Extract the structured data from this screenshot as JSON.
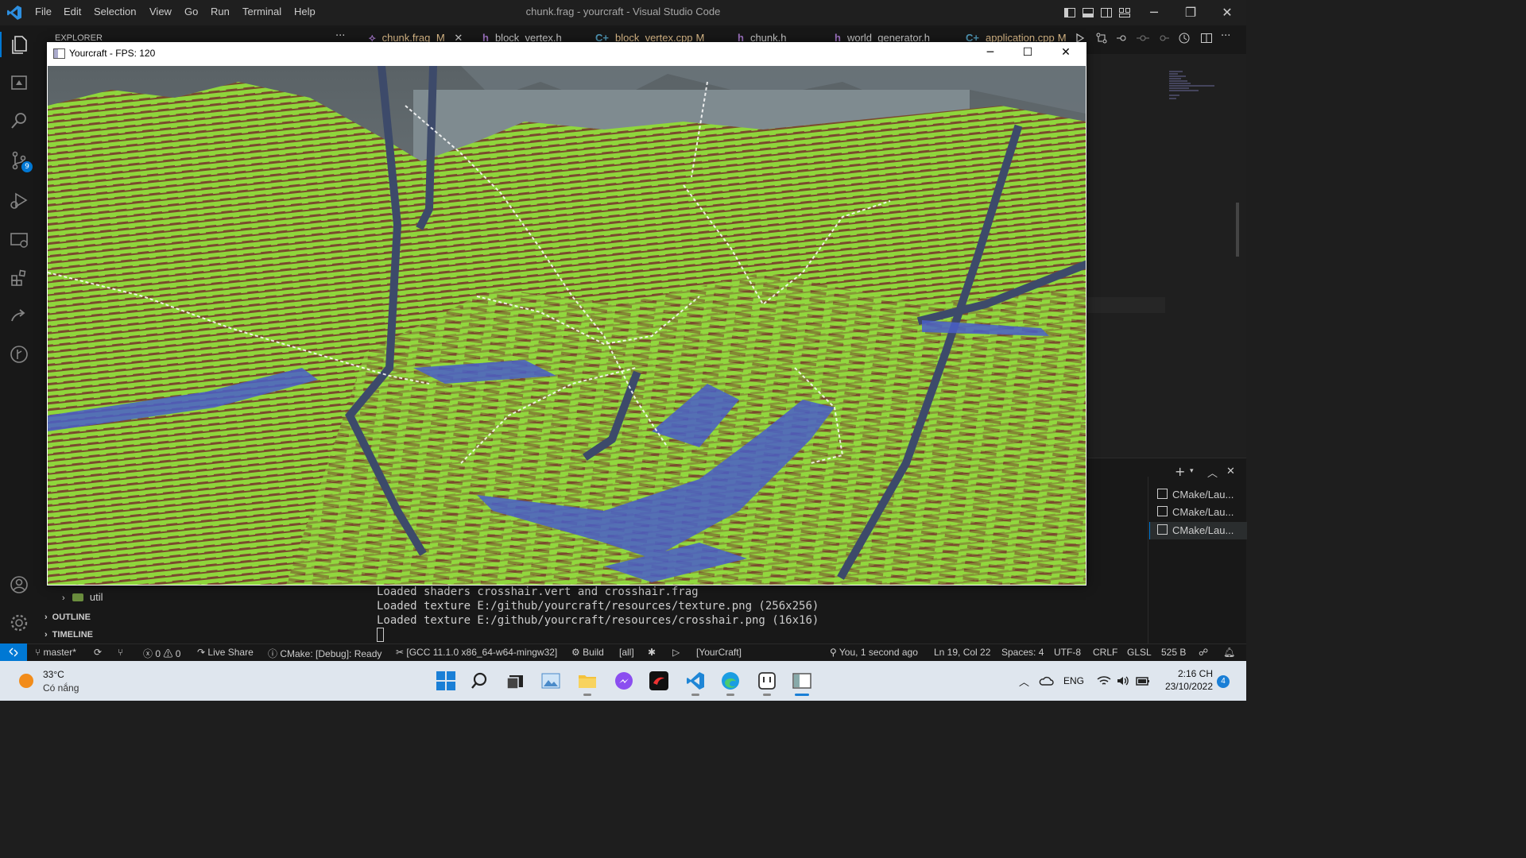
{
  "vscode": {
    "menu": [
      "File",
      "Edit",
      "Selection",
      "View",
      "Go",
      "Run",
      "Terminal",
      "Help"
    ],
    "window_title": "chunk.frag - yourcraft - Visual Studio Code"
  },
  "activity": {
    "scm_badge": "9"
  },
  "sidebar": {
    "title": "EXPLORER",
    "more": "···",
    "folder_util": "util",
    "outline": "OUTLINE",
    "timeline": "TIMELINE"
  },
  "tabs": [
    {
      "prefix": "",
      "label": "chunk.frag",
      "suffix": "M",
      "color": "#e2c08d"
    },
    {
      "prefix": "h",
      "label": "block_vertex.h",
      "suffix": "",
      "color": "#cccccc"
    },
    {
      "prefix": "C+",
      "label": "block_vertex.cpp",
      "suffix": "M",
      "color": "#e2c08d"
    },
    {
      "prefix": "h",
      "label": "chunk.h",
      "suffix": "",
      "color": "#cccccc"
    },
    {
      "prefix": "h",
      "label": "world_generator.h",
      "suffix": "",
      "color": "#cccccc"
    },
    {
      "prefix": "C+",
      "label": "application.cpp",
      "suffix": "M",
      "color": "#e2c08d"
    }
  ],
  "game_window": {
    "title": "Yourcraft - FPS: 120"
  },
  "terminal": {
    "lines": [
      "Loaded shaders crosshair.vert and crosshair.frag",
      "Loaded texture E:/github/yourcraft/resources/texture.png (256x256)",
      "Loaded texture E:/github/yourcraft/resources/crosshair.png (16x16)"
    ],
    "instances": [
      "CMake/Lau...",
      "CMake/Lau...",
      "CMake/Lau..."
    ]
  },
  "statusbar": {
    "branch": "master*",
    "errors": "0",
    "warnings": "0",
    "live_share": "Live Share",
    "cmake_status": "CMake: [Debug]: Ready",
    "kit": "[GCC 11.1.0 x86_64-w64-mingw32]",
    "build": "Build",
    "target": "[all]",
    "launch_target": "[YourCraft]",
    "blame": "You, 1 second ago",
    "position": "Ln 19, Col 22",
    "spaces": "Spaces: 4",
    "encoding": "UTF-8",
    "eol": "CRLF",
    "language": "GLSL",
    "size": "525 B"
  },
  "taskbar": {
    "temperature": "33°C",
    "weather": "Có nắng",
    "language": "ENG",
    "time": "2:16 CH",
    "date": "23/10/2022",
    "notifications": "4"
  },
  "colors": {
    "accent": "#0078d4",
    "grass": "#8fd63c",
    "dirt": "#7a4a2e",
    "water": "#4a5fc9",
    "modified": "#e2c08d"
  }
}
